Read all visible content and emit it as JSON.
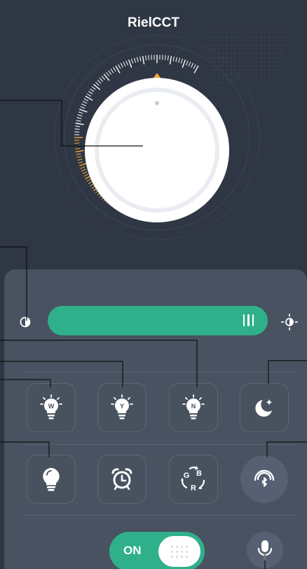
{
  "app": {
    "title": "RielCCT"
  },
  "colors": {
    "background": "#2f3644",
    "panel": "#485261",
    "accent_green": "#2fb08a",
    "dial_active_ticks": "#f2a93b",
    "dial_inactive_ticks": "#ffffff"
  },
  "dial": {
    "level": 0.5,
    "indicator_icon": "triangle-pointer-icon"
  },
  "brightness": {
    "level": 0.95,
    "min_icon": "half-circle-icon",
    "max_icon": "sun-icon"
  },
  "presets": [
    {
      "letter": "W",
      "icon": "bulb-w-icon"
    },
    {
      "letter": "Y",
      "icon": "bulb-y-icon"
    },
    {
      "letter": "N",
      "icon": "bulb-n-icon"
    },
    {
      "letter": "",
      "icon": "moon-icon"
    }
  ],
  "tools": [
    {
      "icon": "bulb-icon"
    },
    {
      "icon": "alarm-clock-icon"
    },
    {
      "letters": [
        "G",
        "B",
        "R"
      ],
      "icon": "rgb-cycle-icon"
    },
    {
      "icon": "bluetooth-signal-icon"
    }
  ],
  "power": {
    "label": "ON",
    "state": "on"
  },
  "voice": {
    "icon": "microphone-icon"
  }
}
